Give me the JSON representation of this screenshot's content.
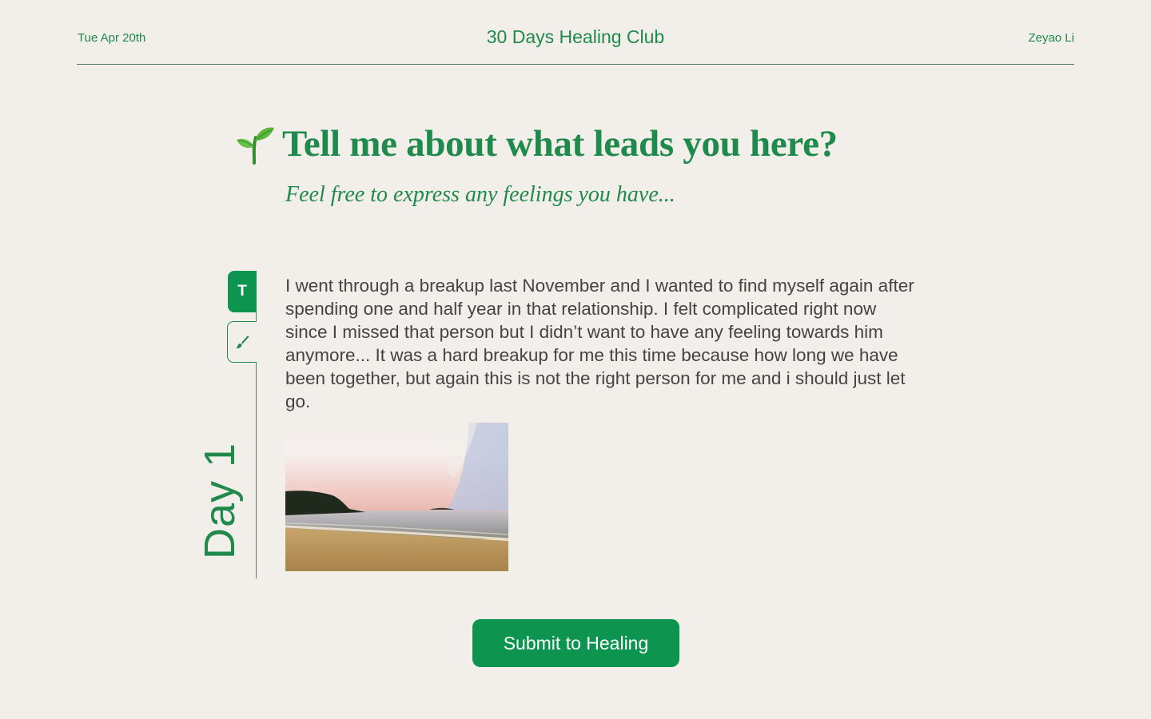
{
  "header": {
    "date": "Tue Apr 20th",
    "title": "30 Days Healing Club",
    "user": "Zeyao Li"
  },
  "prompt": {
    "icon": "sprout-icon",
    "heading": "Tell me about what leads you here?",
    "subheading": "Feel free to express any feelings you have..."
  },
  "toolbar": {
    "text_tool_label": "T",
    "brush_tool_icon": "paintbrush-icon"
  },
  "day_label": "Day 1",
  "entry": {
    "text": "I went through a breakup last November and I wanted to find myself again after spending one and half year in that relationship. I felt complicated right now since I missed that person but I didn’t want to have any feeling towards him anymore... It was a hard breakup for me this time because how long we have been together, but again this is not the right person for me and i should just let go.",
    "image": "beach-sunset-photo"
  },
  "submit_label": "Submit to Healing",
  "colors": {
    "background": "#f2eee9",
    "accent": "#0d9550",
    "text_green": "#1f8a4c",
    "body_text": "#444444"
  }
}
